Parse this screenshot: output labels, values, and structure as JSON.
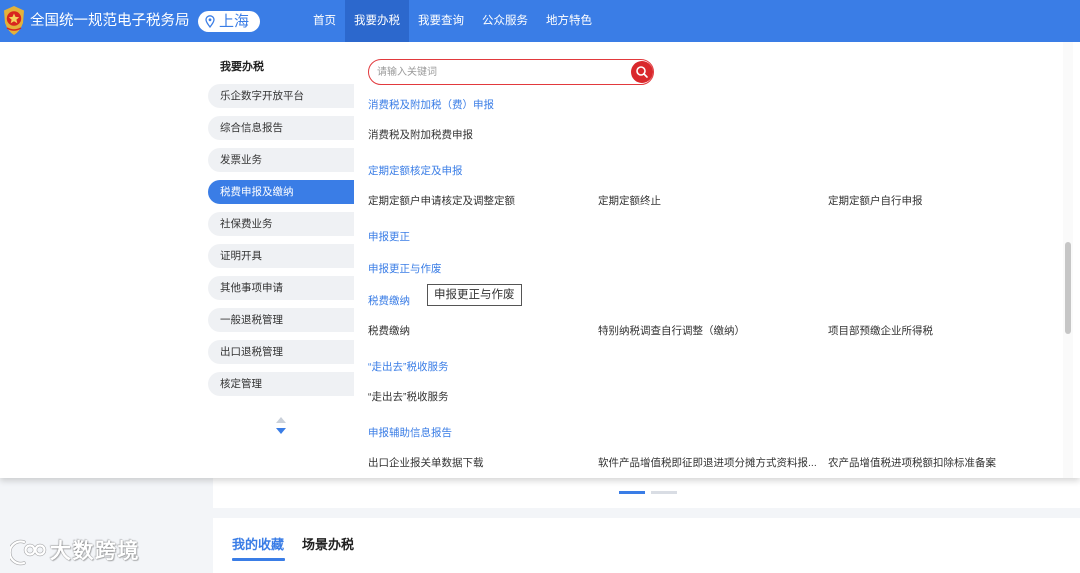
{
  "header": {
    "site_title": "全国统一规范电子税务局",
    "location": "上海",
    "nav": [
      {
        "label": "首页",
        "active": false
      },
      {
        "label": "我要办税",
        "active": true
      },
      {
        "label": "我要查询",
        "active": false
      },
      {
        "label": "公众服务",
        "active": false
      },
      {
        "label": "地方特色",
        "active": false
      }
    ]
  },
  "sidebar": {
    "title": "我要办税",
    "items": [
      {
        "label": "乐企数字开放平台",
        "active": false
      },
      {
        "label": "综合信息报告",
        "active": false
      },
      {
        "label": "发票业务",
        "active": false
      },
      {
        "label": "税费申报及缴纳",
        "active": true
      },
      {
        "label": "社保费业务",
        "active": false
      },
      {
        "label": "证明开具",
        "active": false
      },
      {
        "label": "其他事项申请",
        "active": false
      },
      {
        "label": "一般退税管理",
        "active": false
      },
      {
        "label": "出口退税管理",
        "active": false
      },
      {
        "label": "核定管理",
        "active": false
      }
    ]
  },
  "search": {
    "placeholder": "请输入关键词"
  },
  "sections": [
    {
      "title": "消费税及附加税（费）申报",
      "items": [
        "消费税及附加税费申报"
      ]
    },
    {
      "title": "定期定额核定及申报",
      "items": [
        "定期定额户申请核定及调整定额",
        "定期定额终止",
        "定期定额户自行申报"
      ]
    },
    {
      "title": "申报更正",
      "items": []
    },
    {
      "title": "申报更正与作废",
      "items": []
    },
    {
      "title": "税费缴纳",
      "items": [
        "税费缴纳",
        "特别纳税调查自行调整（缴纳）",
        "项目部预缴企业所得税"
      ]
    },
    {
      "title": "“走出去”税收服务",
      "items": [
        "“走出去”税收服务"
      ]
    },
    {
      "title": "申报辅助信息报告",
      "items": [
        "出口企业报关单数据下载",
        "软件产品增值税即征即退进项分摊方式资料报...",
        "农产品增值税进项税额扣除标准备案"
      ]
    }
  ],
  "tooltip": "申报更正与作废",
  "carousel": {
    "dots": [
      {
        "active": true
      },
      {
        "active": false
      }
    ]
  },
  "lower_tabs": [
    {
      "label": "我的收藏",
      "active": true
    },
    {
      "label": "场景办税",
      "active": false
    }
  ],
  "watermark": "大数跨境",
  "colors": {
    "brand_blue": "#3a7de6",
    "nav_active_bg": "#2c68cd",
    "search_red": "#d9282c",
    "sidebar_pill": "#eff1f4",
    "text_main": "#333333",
    "page_bg": "#f3f5f8"
  },
  "icons": {
    "logo": "tax-emblem",
    "location": "map-pin",
    "search": "magnifier",
    "sidebar_scroll": [
      "triangle-up",
      "triangle-down"
    ],
    "watermark_logo": "brand-mark"
  }
}
